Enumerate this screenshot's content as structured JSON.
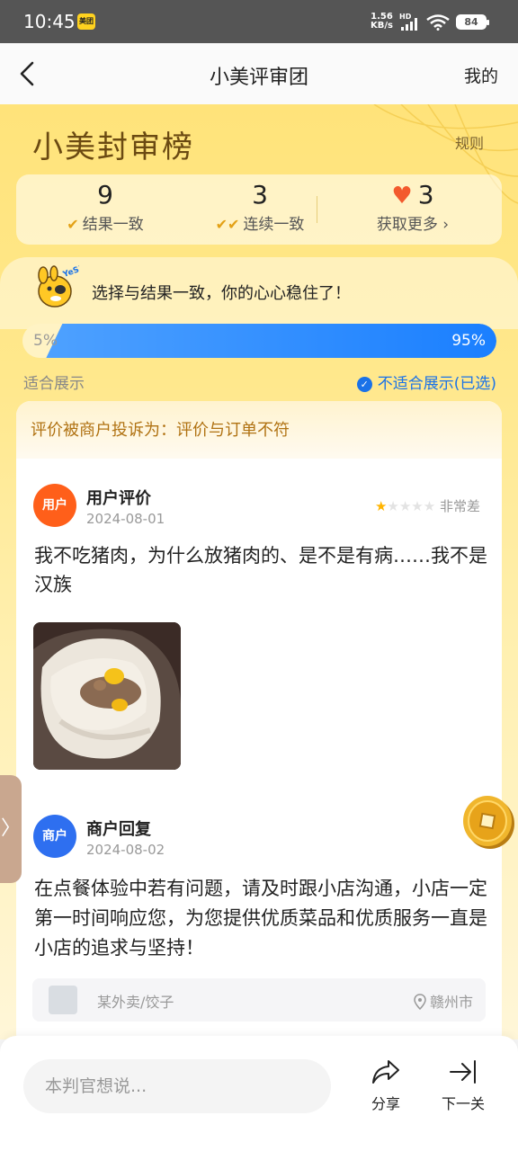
{
  "status_bar": {
    "time": "10:45",
    "app_badge": "美团",
    "net_speed_top": "1.56",
    "net_speed_bottom": "KB/s",
    "hd": "HD",
    "battery": "84"
  },
  "nav": {
    "title": "小美评审团",
    "right": "我的"
  },
  "board": {
    "title": "小美封审榜",
    "rules": "规则"
  },
  "stats": [
    {
      "value": "9",
      "label": "结果一致"
    },
    {
      "value": "3",
      "label": "连续一致"
    },
    {
      "value": "3",
      "label": "获取更多 ›"
    }
  ],
  "result": {
    "mascot_text": "YeS!",
    "message": "选择与结果一致，你的心心稳住了！"
  },
  "vote": {
    "left_percent": "5%",
    "right_percent": "95%",
    "right_fraction": 0.95,
    "left_option": "适合展示",
    "right_option": "不适合展示(已选)"
  },
  "card": {
    "complaint": "评价被商户投诉为：评价与订单不符",
    "user": {
      "avatar": "用户",
      "title": "用户评价",
      "date": "2024-08-01",
      "rating_stars": 1,
      "rating_text": "非常差",
      "text": "我不吃猪肉，为什么放猪肉的、是不是有病……我不是汉族"
    },
    "merchant": {
      "avatar": "商户",
      "title": "商户回复",
      "date": "2024-08-02",
      "text": "在点餐体验中若有问题，请及时跟小店沟通，小店一定第一时间响应您，为您提供优质菜品和优质服务一直是小店的追求与坚持！"
    },
    "shop": {
      "name": "某外卖/饺子",
      "location": "赣州市"
    }
  },
  "bottom": {
    "input_placeholder": "本判官想说...",
    "share": "分享",
    "next": "下一关"
  },
  "colors": {
    "accent_yellow": "#ffe37a",
    "progress_blue": "#1a7fff",
    "user_orange": "#ff5f1a",
    "merchant_blue": "#2e6ff0",
    "heart_red": "#f35a2d"
  }
}
